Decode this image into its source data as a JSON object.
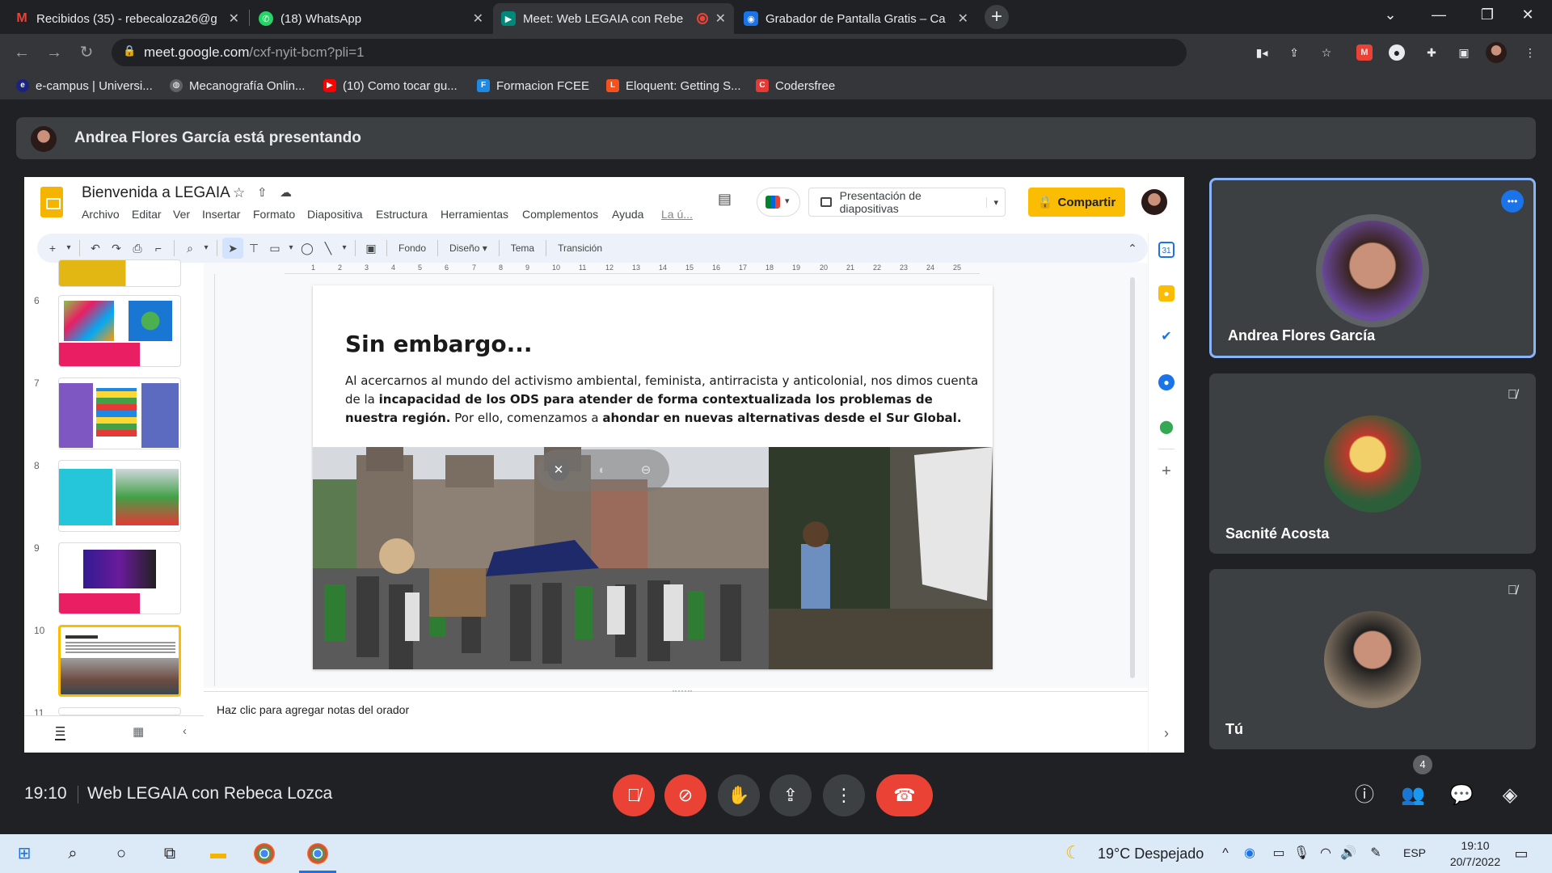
{
  "browser": {
    "tabs": [
      {
        "title": "Recibidos (35) - rebecaloza26@g",
        "icon": "gmail-icon",
        "color": "#ea4335",
        "letter": "M"
      },
      {
        "title": "(18) WhatsApp",
        "icon": "whatsapp-icon",
        "color": "#25d366",
        "letter": "18"
      },
      {
        "title": "Meet: Web LEGAIA con Rebe",
        "icon": "meet-icon",
        "color": "#00897b",
        "letter": "▶"
      },
      {
        "title": "Grabador de Pantalla Gratis – Ca",
        "icon": "recorder-icon",
        "color": "#1a73e8",
        "letter": "◉"
      }
    ],
    "url_host": "meet.google.com",
    "url_path": "/cxf-nyit-bcm?pli=1",
    "bookmarks": [
      {
        "label": "e-campus | Universi...",
        "icon": "ecampus-icon",
        "color": "#1a237e"
      },
      {
        "label": "Mecanografía Onlin...",
        "icon": "globe-icon",
        "color": "#5f6368"
      },
      {
        "label": "(10) Como tocar gu...",
        "icon": "youtube-icon",
        "color": "#ff0000"
      },
      {
        "label": "Formacion FCEE",
        "icon": "formacion-icon",
        "color": "#1e88e5"
      },
      {
        "label": "Eloquent: Getting S...",
        "icon": "laravel-icon",
        "color": "#f4511e"
      },
      {
        "label": "Codersfree",
        "icon": "codersfree-icon",
        "color": "#e53935"
      }
    ]
  },
  "meet": {
    "presenting_text": "Andrea Flores García está presentando",
    "time": "19:10",
    "meeting_title": "Web LEGAIA con Rebeca Lozca",
    "people_count": "4",
    "participants": [
      {
        "name": "Andrea Flores García",
        "speaking": true
      },
      {
        "name": "Sacnité Acosta",
        "muted": true
      },
      {
        "name": "Tú",
        "muted": true
      }
    ]
  },
  "slides": {
    "title": "Bienvenida a LEGAIA",
    "menus": [
      "Archivo",
      "Editar",
      "Ver",
      "Insertar",
      "Formato",
      "Diapositiva",
      "Estructura",
      "Herramientas",
      "Complementos",
      "Ayuda",
      "La ú..."
    ],
    "slideshow_label": "Presentación de diapositivas",
    "share_label": "Compartir",
    "toolbar_text": [
      "Fondo",
      "Diseño ▾",
      "Tema",
      "Transición"
    ],
    "ruler_marks": [
      "1",
      "2",
      "3",
      "4",
      "5",
      "6",
      "7",
      "8",
      "9",
      "10",
      "11",
      "12",
      "13",
      "14",
      "15",
      "16",
      "17",
      "18",
      "19",
      "20",
      "21",
      "22",
      "23",
      "24",
      "25"
    ],
    "thumb_numbers": [
      "6",
      "7",
      "8",
      "9",
      "10",
      "11"
    ],
    "notes_placeholder": "Haz clic para agregar notas del orador",
    "current_slide": {
      "heading": "Sin embargo...",
      "body_1": "Al acercarnos al mundo del activismo ambiental, feminista, antirracista y anticolonial, nos dimos cuenta de la ",
      "body_bold_1": "incapacidad de los ODS para atender de forma contextualizada los problemas de nuestra región.",
      "body_2": " Por ello, comenzamos a ",
      "body_bold_2": "ahondar en nuevas alternativas desde el Sur Global."
    }
  },
  "taskbar": {
    "weather": "19°C  Despejado",
    "lang": "ESP",
    "clock_time": "19:10",
    "clock_date": "20/7/2022"
  }
}
